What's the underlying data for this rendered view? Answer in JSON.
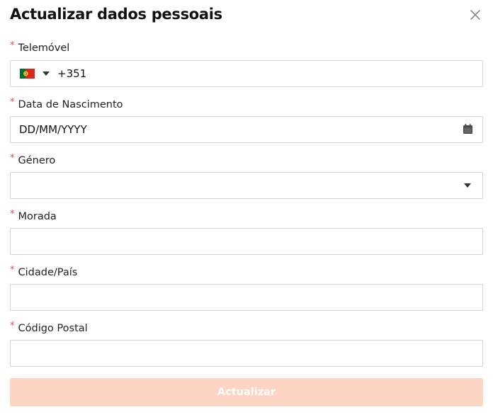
{
  "modal": {
    "title": "Actualizar dados pessoais",
    "close_icon": "close-icon"
  },
  "fields": {
    "phone": {
      "label": "Telemóvel",
      "required_mark": "*",
      "country_flag": "portugal-flag-icon",
      "dial_code": "+351"
    },
    "birthdate": {
      "label": "Data de Nascimento",
      "required_mark": "*",
      "placeholder": "DD/MM/YYYY",
      "icon": "calendar-icon"
    },
    "gender": {
      "label": "Género",
      "required_mark": "*",
      "value": "",
      "icon": "chevron-down-icon"
    },
    "address": {
      "label": "Morada",
      "required_mark": "*",
      "value": ""
    },
    "city_country": {
      "label": "Cidade/País",
      "required_mark": "*",
      "value": ""
    },
    "postal_code": {
      "label": "Código Postal",
      "required_mark": "*",
      "value": ""
    }
  },
  "submit": {
    "label": "Actualizar",
    "disabled": true
  },
  "colors": {
    "required": "#e5484d",
    "button_disabled_bg": "#fdd5c5",
    "border": "#d4d4d4",
    "flag_green": "#046a38",
    "flag_red": "#da291c",
    "flag_yellow": "#ffe900"
  }
}
